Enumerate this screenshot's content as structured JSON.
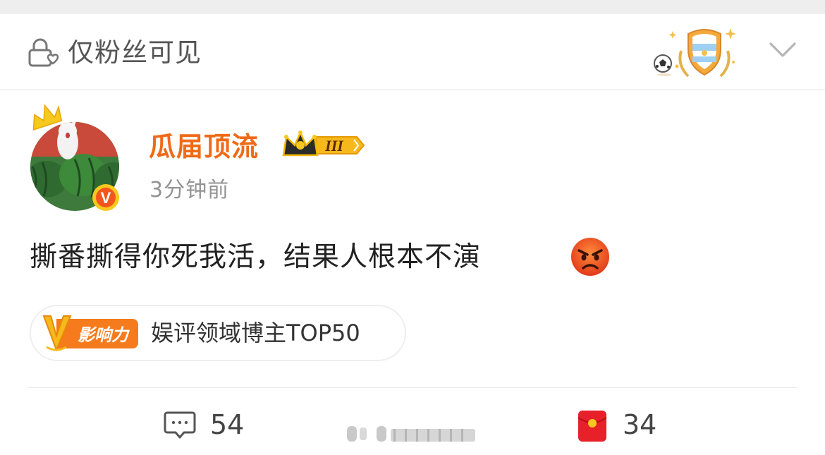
{
  "visibility": {
    "label": "仅粉丝可见",
    "lock_icon": "lock-heart-icon",
    "badge_icon": "argentina-shield-badge-icon",
    "expand_icon": "chevron-down-icon"
  },
  "author": {
    "name": "瓜届顶流",
    "name_color": "#f06a17",
    "vip_level": "III",
    "avatar_icon": "cat-watermelon-avatar",
    "verified_mark": "V",
    "posted_time": "3分钟前"
  },
  "post": {
    "text": "撕番撕得你死我活，结果人根本不演",
    "emoji": "angry-face-icon"
  },
  "influence": {
    "logo_letter": "V",
    "logo_text": "影响力",
    "label": "娱评领域博主TOP50"
  },
  "actions": {
    "comment_count": "54",
    "redpacket_count": "34"
  },
  "colors": {
    "accent_orange": "#f06a17",
    "redpacket_red": "#e8202a",
    "gold": "#f5b800"
  }
}
